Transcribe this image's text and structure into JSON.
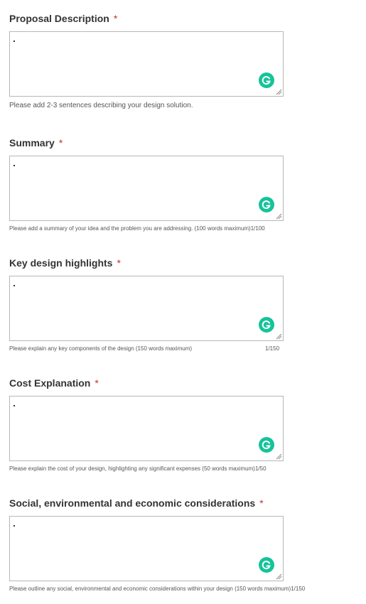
{
  "required_mark": "*",
  "fields": [
    {
      "label": "Proposal Description",
      "value": ".",
      "help": "Please add 2-3 sentences describing your design solution.",
      "counter": ""
    },
    {
      "label": "Summary",
      "value": ".",
      "help": "Please add a summary of your idea and the problem you are addressing. (100 words maximum)",
      "counter": "1/100"
    },
    {
      "label": "Key design highlights",
      "value": ".",
      "help": "Please explain any key components of the design (150 words maximum)",
      "counter": "1/150"
    },
    {
      "label": "Cost Explanation",
      "value": ".",
      "help": "Please explain the cost of your design, highlighting any significant expenses (50 words maximum)",
      "counter": "1/50"
    },
    {
      "label": "Social, environmental and economic considerations",
      "value": ".",
      "help": "Please outline any social, environmental and economic considerations within your design (150 words maximum)",
      "counter": "1/150"
    }
  ],
  "colors": {
    "required": "#c9302c",
    "grammarly": "#15c39a",
    "border": "#b7b7b7"
  },
  "icons": {
    "grammarly": "grammarly-icon",
    "resize": "resize-handle-icon"
  }
}
